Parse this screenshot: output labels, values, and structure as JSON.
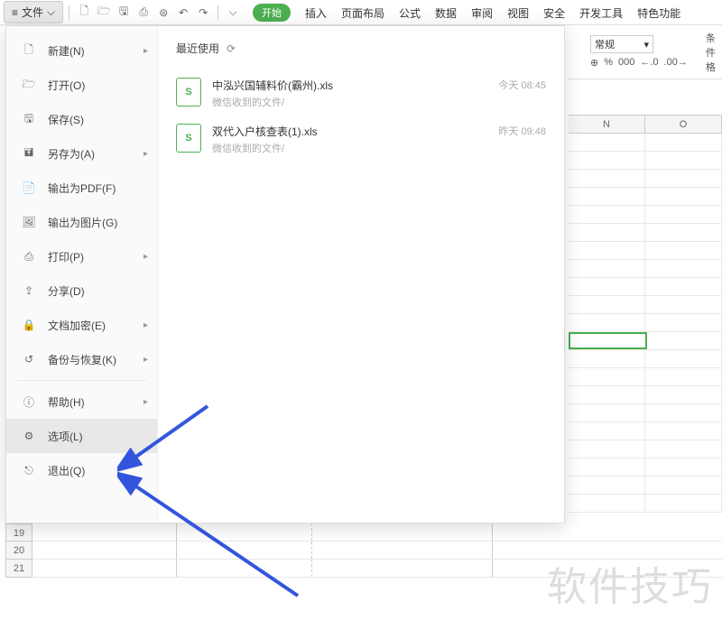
{
  "file_button": "文件",
  "ribbon": {
    "start": "开始",
    "tabs": [
      "插入",
      "页面布局",
      "公式",
      "数据",
      "审阅",
      "视图",
      "安全",
      "开发工具",
      "特色功能"
    ],
    "number_format_label": "常规",
    "cond_format": "条件格",
    "num_icons": [
      "⊕",
      "%",
      "000",
      "←.0",
      ".00→"
    ]
  },
  "menu": {
    "items": [
      {
        "label": "新建(N)",
        "icon": "new",
        "arrow": true
      },
      {
        "label": "打开(O)",
        "icon": "open"
      },
      {
        "label": "保存(S)",
        "icon": "save"
      },
      {
        "label": "另存为(A)",
        "icon": "saveas",
        "arrow": true
      },
      {
        "label": "输出为PDF(F)",
        "icon": "pdf"
      },
      {
        "label": "输出为图片(G)",
        "icon": "img"
      },
      {
        "label": "打印(P)",
        "icon": "print",
        "arrow": true
      },
      {
        "label": "分享(D)",
        "icon": "share"
      },
      {
        "label": "文档加密(E)",
        "icon": "lock",
        "arrow": true
      },
      {
        "label": "备份与恢复(K)",
        "icon": "backup",
        "arrow": true
      },
      {
        "label": "帮助(H)",
        "icon": "help",
        "arrow": true
      },
      {
        "label": "选项(L)",
        "icon": "options"
      },
      {
        "label": "退出(Q)",
        "icon": "exit"
      }
    ],
    "recent_label": "最近使用",
    "recent_files": [
      {
        "name": "中泓兴国辅料价(霸州).xls",
        "path": "微信收到的文件/",
        "time": "今天 08:45"
      },
      {
        "name": "双代入户核查表(1).xls",
        "path": "微信收到的文件/",
        "time": "昨天 09:48"
      }
    ]
  },
  "columns": [
    "N",
    "O"
  ],
  "row_numbers": [
    "19",
    "20",
    "21"
  ],
  "watermark": "软件技巧"
}
